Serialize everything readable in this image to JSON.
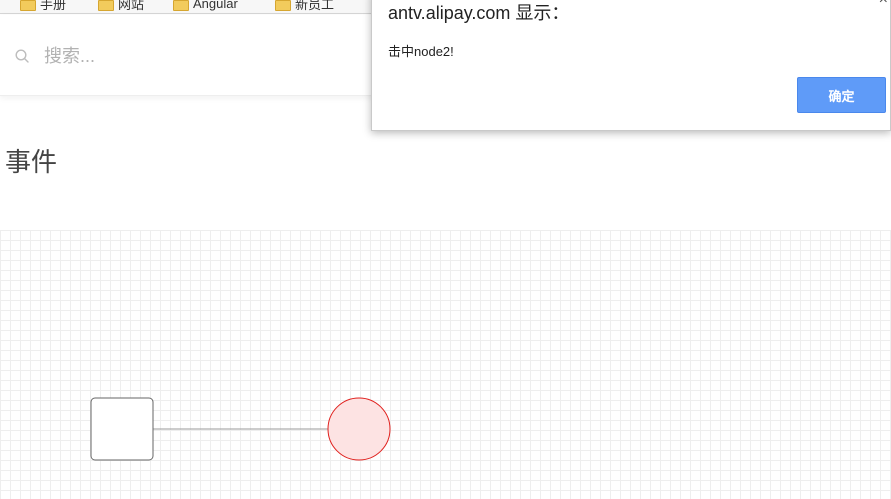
{
  "bookmarks": {
    "items": [
      {
        "label": "手册",
        "icon": "folder-icon"
      },
      {
        "label": "网站",
        "icon": "folder-icon"
      },
      {
        "label": "Angular",
        "icon": "folder-icon"
      },
      {
        "label": "新员工",
        "icon": "folder-icon"
      }
    ]
  },
  "search": {
    "placeholder": "搜索...",
    "icon": "search-icon"
  },
  "page": {
    "title": "事件"
  },
  "graph": {
    "nodes": [
      {
        "id": "node1",
        "shape": "rect",
        "fill": "#ffffff",
        "stroke": "#666666"
      },
      {
        "id": "node2",
        "shape": "circle",
        "fill": "#fde3e3",
        "stroke": "#e0201d"
      }
    ],
    "edges": [
      {
        "source": "node1",
        "target": "node2",
        "stroke": "#999999"
      }
    ]
  },
  "dialog": {
    "title": "antv.alipay.com 显示：",
    "message": "击中node2!",
    "ok_label": "确定",
    "close_glyph": "×",
    "accent": "#5f9bf8"
  }
}
